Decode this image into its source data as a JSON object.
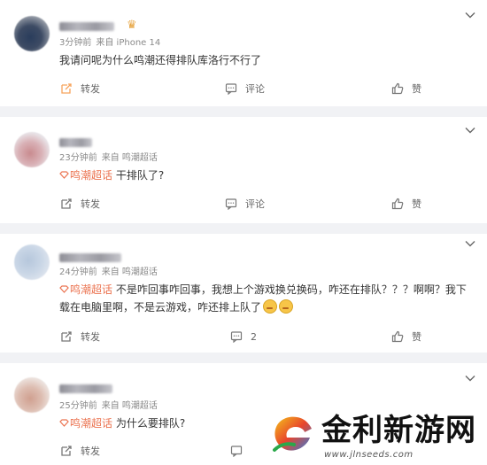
{
  "comments": [
    {
      "time": "3分钟前",
      "source": "来自 iPhone 14",
      "topic": "",
      "text": "我请问呢为什么鸣潮还得排队库洛行不行了",
      "text_line2": "",
      "actions": {
        "repost": "转发",
        "comment": "评论",
        "like": "赞"
      }
    },
    {
      "time": "23分钟前",
      "source": "来自 鸣潮超话",
      "topic": "鸣潮超话",
      "text": " 干排队了?",
      "text_line2": "",
      "actions": {
        "repost": "转发",
        "comment": "评论",
        "like": "赞"
      }
    },
    {
      "time": "24分钟前",
      "source": "来自 鸣潮超话",
      "topic": "鸣潮超话",
      "text": " 不是咋回事咋回事，我想上个游戏换兑换码，咋还在排队？？？啊啊？我下",
      "text_line2": "载在电脑里啊，不是云游戏，咋还排上队了",
      "actions": {
        "repost": "转发",
        "comment": "2",
        "like": "赞"
      }
    },
    {
      "time": "25分钟前",
      "source": "来自 鸣潮超话",
      "topic": "鸣潮超话",
      "text": " 为什么要排队?",
      "text_line2": "",
      "actions": {
        "repost": "转发",
        "comment": "",
        "like": ""
      }
    }
  ],
  "watermark": {
    "title": "金利新游网",
    "url": "www.jlnseeds.com"
  },
  "colors": {
    "topic": "#eb7350",
    "divider": "#f1f2f5",
    "meta": "#8a8a8a",
    "repost_highlight": "#f7a35c"
  }
}
